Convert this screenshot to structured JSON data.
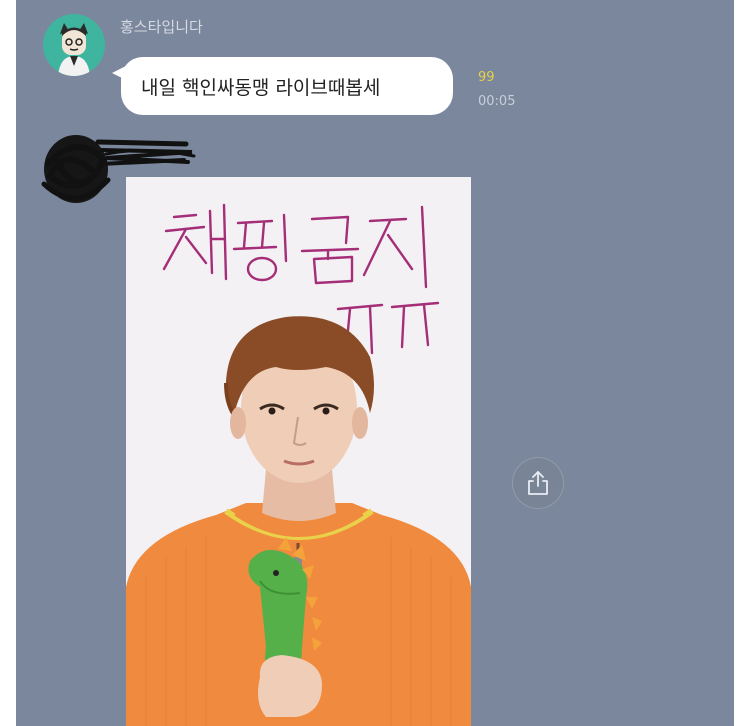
{
  "chat": {
    "sender_name": "홍스타입니다",
    "message_text": "내일 핵인싸동맹 라이브때봅세",
    "unread_count": "99",
    "timestamp": "00:05"
  },
  "photo": {
    "handwriting_lines": [
      "채팅금지",
      "ㅠㅠ"
    ]
  },
  "colors": {
    "chat_background": "#7b879c",
    "bubble": "#ffffff",
    "unread": "#e7d04a",
    "avatar_bg": "#3fb5a0",
    "sweater": "#f08a3e",
    "handwriting": "#a52e78"
  },
  "icons": {
    "share": "share-icon",
    "avatar": "profile-avatar",
    "redaction": "scribble-redaction"
  }
}
